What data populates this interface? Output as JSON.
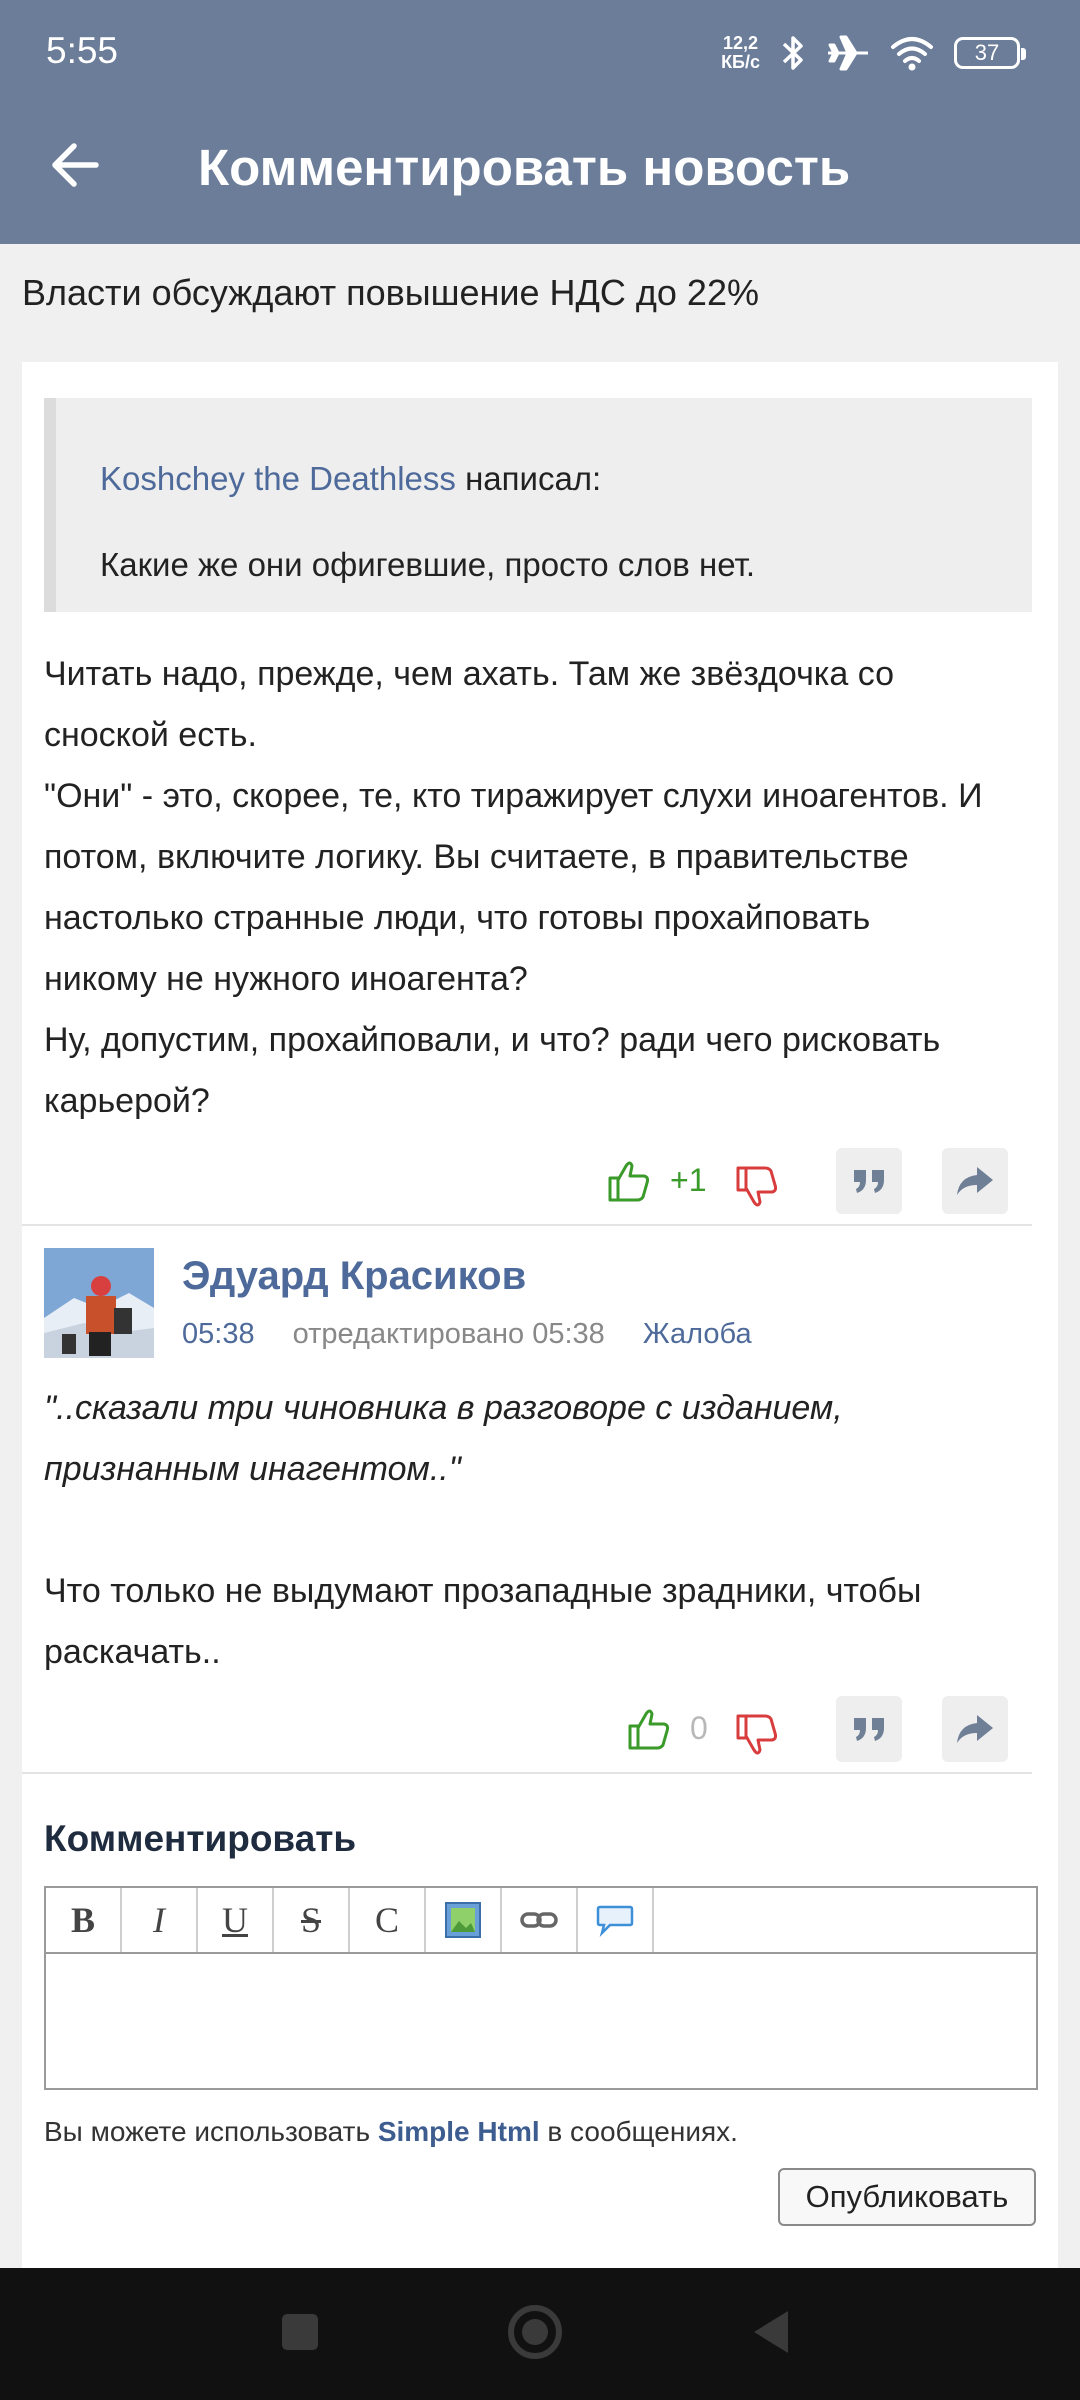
{
  "status_bar": {
    "time": "5:55",
    "net_speed_value": "12,2",
    "net_speed_unit": "КБ/с",
    "battery": "37"
  },
  "header": {
    "title": "Комментировать новость"
  },
  "news": {
    "title": "Власти обсуждают повышение НДС до 22%"
  },
  "comments": [
    {
      "quote": {
        "author": "Koshchey the Deathless",
        "wrote_label": "написал:",
        "text": "Какие же они офигевшие, просто слов нет."
      },
      "text_lines": [
        "Читать надо, прежде, чем ахать. Там же звёздочка со",
        "сноской есть.",
        "\"Они\" - это, скорее, те, кто тиражирует слухи иноагентов. И",
        "потом, включите логику. Вы считаете, в правительстве",
        "настолько странные люди, что готовы прохайповать",
        "никому не нужного иноагента?",
        "Ну, допустим, прохайповали, и что? ради чего рисковать",
        "карьерой?"
      ],
      "score": "+1"
    },
    {
      "author": "Эдуард Красиков",
      "time": "05:38",
      "edited": "отредактировано 05:38",
      "complaint": "Жалоба",
      "italic_lines": [
        "\"..сказали три чиновника в разговоре с изданием,",
        "признанным инагентом..\""
      ],
      "text_lines": [
        "Что только не выдумают прозападные зрадники, чтобы",
        "раскачать.."
      ],
      "score": "0"
    }
  ],
  "comment_form": {
    "title": "Комментировать",
    "toolbar": [
      "B",
      "I",
      "U",
      "S",
      "C"
    ],
    "hint_before": "Вы можете использовать ",
    "hint_link": "Simple Html",
    "hint_after": " в сообщениях.",
    "publish_label": "Опубликовать"
  },
  "colors": {
    "header_bg": "#6b7d99",
    "link": "#4d6a9a",
    "like_green": "#3a9a2a",
    "dislike_red": "#d83c3c"
  }
}
